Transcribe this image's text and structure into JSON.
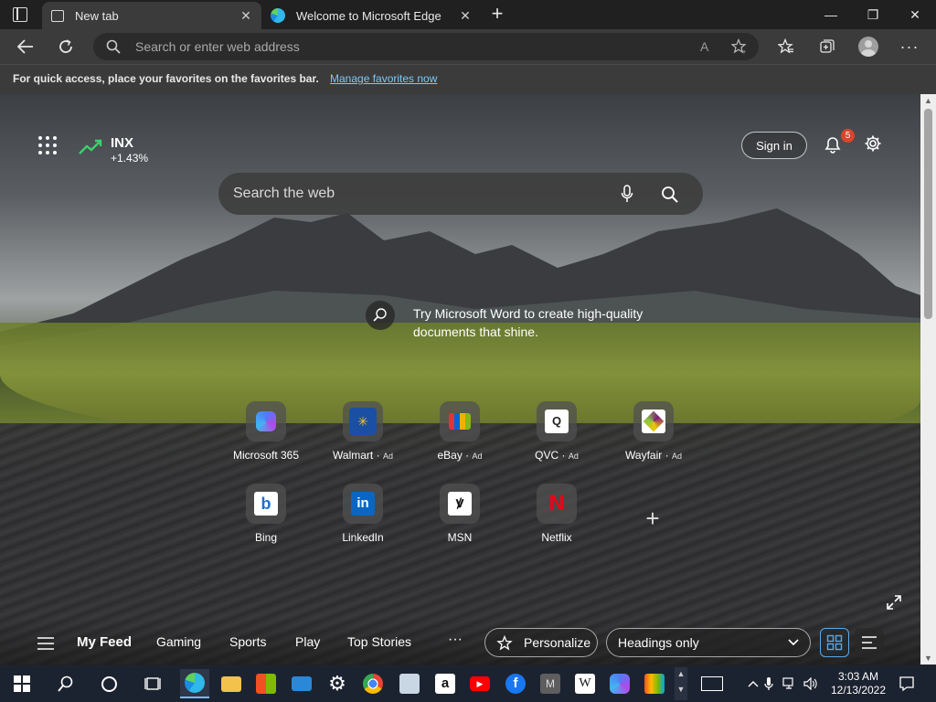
{
  "tabs": [
    {
      "label": "New tab",
      "icon": "new-tab-page-icon",
      "active": true
    },
    {
      "label": "Welcome to Microsoft Edge",
      "icon": "edge-icon",
      "active": false
    }
  ],
  "window_controls": {
    "minimize": "—",
    "restore": "❐",
    "close": "✕"
  },
  "address_bar": {
    "placeholder": "Search or enter web address"
  },
  "favorites_notice": {
    "message": "For quick access, place your favorites on the favorites bar.",
    "link": "Manage favorites now"
  },
  "stock": {
    "symbol": "INX",
    "change": "+1.43%",
    "color": "#3bd16f"
  },
  "sign_in_label": "Sign in",
  "notifications_count": "5",
  "web_search": {
    "placeholder": "Search the web"
  },
  "promo": {
    "text": "Try Microsoft Word to create high-quality documents that shine."
  },
  "quick_links": [
    {
      "label": "Microsoft 365",
      "ad": ""
    },
    {
      "label": "Walmart",
      "ad": "Ad"
    },
    {
      "label": "eBay",
      "ad": "Ad"
    },
    {
      "label": "QVC",
      "ad": "Ad"
    },
    {
      "label": "Wayfair",
      "ad": "Ad"
    },
    {
      "label": "Bing",
      "ad": ""
    },
    {
      "label": "LinkedIn",
      "ad": ""
    },
    {
      "label": "MSN",
      "ad": ""
    },
    {
      "label": "Netflix",
      "ad": ""
    }
  ],
  "feed": {
    "tabs": [
      "My Feed",
      "Gaming",
      "Sports",
      "Play",
      "Top Stories"
    ],
    "more": "···",
    "personalize": "Personalize",
    "headings_select": "Headings only"
  },
  "clock": {
    "time": "3:03 AM",
    "date": "12/13/2022"
  },
  "colors": {
    "accent": "#7ec8f5",
    "badge": "#d9452b",
    "taskbar": "#1c2330"
  }
}
